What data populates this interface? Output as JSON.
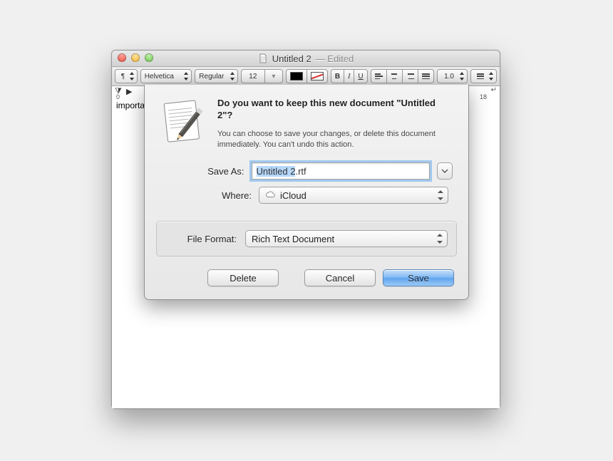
{
  "window": {
    "title": "Untitled 2",
    "title_suffix": "— Edited"
  },
  "toolbar": {
    "para_style": "¶",
    "font_family": "Helvetica",
    "font_style": "Regular",
    "font_size": "12",
    "bold": "B",
    "italic": "I",
    "underline": "U",
    "line_spacing": "1.0",
    "list_style": "≡"
  },
  "ruler": {
    "left_mark": "0",
    "right_mark": "18"
  },
  "document_text": "importa",
  "dialog": {
    "headline": "Do you want to keep this new document \"Untitled 2\"?",
    "subline": "You can choose to save your changes, or delete this document immediately. You can't undo this action.",
    "save_as_label": "Save As:",
    "filename_selected": "Untitled 2",
    "filename_ext": ".rtf",
    "where_label": "Where:",
    "where_value": "iCloud",
    "file_format_label": "File Format:",
    "file_format_value": "Rich Text Document",
    "delete_label": "Delete",
    "cancel_label": "Cancel",
    "save_label": "Save"
  }
}
